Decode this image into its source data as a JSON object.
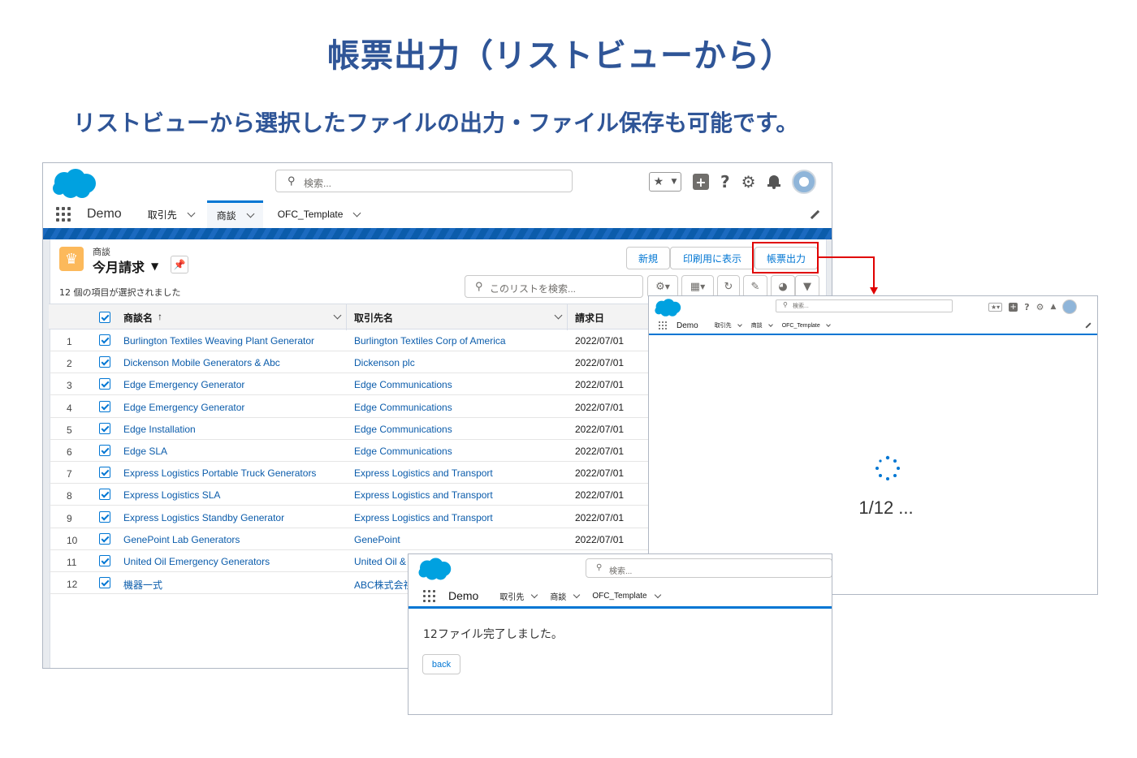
{
  "slide": {
    "title": "帳票出力（リストビューから）",
    "subtitle": "リストビューから選択したファイルの出力・ファイル保存も可能です。"
  },
  "app": {
    "search_placeholder": "検索...",
    "app_name": "Demo",
    "nav_items": [
      "取引先",
      "商談",
      "OFC_Template"
    ]
  },
  "list_view": {
    "object_label": "商談",
    "view_name": "今月請求",
    "selected_status": "12 個の項目が選択されました",
    "buttons": {
      "new": "新規",
      "print_view": "印刷用に表示",
      "report_output": "帳票出力"
    },
    "list_search_placeholder": "このリストを検索...",
    "columns": [
      "商談名",
      "取引先名",
      "請求日"
    ],
    "sort_indicator": "↑",
    "rows": [
      {
        "n": "1",
        "opp": "Burlington Textiles Weaving Plant Generator",
        "acc": "Burlington Textiles Corp of America",
        "date": "2022/07/01"
      },
      {
        "n": "2",
        "opp": "Dickenson Mobile Generators & Abc",
        "acc": "Dickenson plc",
        "date": "2022/07/01"
      },
      {
        "n": "3",
        "opp": "Edge Emergency Generator",
        "acc": "Edge Communications",
        "date": "2022/07/01"
      },
      {
        "n": "4",
        "opp": "Edge Emergency Generator",
        "acc": "Edge Communications",
        "date": "2022/07/01"
      },
      {
        "n": "5",
        "opp": "Edge Installation",
        "acc": "Edge Communications",
        "date": "2022/07/01"
      },
      {
        "n": "6",
        "opp": "Edge SLA",
        "acc": "Edge Communications",
        "date": "2022/07/01"
      },
      {
        "n": "7",
        "opp": "Express Logistics Portable Truck Generators",
        "acc": "Express Logistics and Transport",
        "date": "2022/07/01"
      },
      {
        "n": "8",
        "opp": "Express Logistics SLA",
        "acc": "Express Logistics and Transport",
        "date": "2022/07/01"
      },
      {
        "n": "9",
        "opp": "Express Logistics Standby Generator",
        "acc": "Express Logistics and Transport",
        "date": "2022/07/01"
      },
      {
        "n": "10",
        "opp": "GenePoint Lab Generators",
        "acc": "GenePoint",
        "date": "2022/07/01"
      },
      {
        "n": "11",
        "opp": "United Oil Emergency Generators",
        "acc": "United Oil &",
        "date": ""
      },
      {
        "n": "12",
        "opp": "機器一式",
        "acc": "ABC株式会社",
        "date": ""
      }
    ]
  },
  "progress": {
    "text": "1/12 ..."
  },
  "complete": {
    "message": "12ファイル完了しました。",
    "back_label": "back"
  },
  "colors": {
    "title": "#2f5597",
    "brand": "#0176d3",
    "highlight": "#e00000"
  }
}
